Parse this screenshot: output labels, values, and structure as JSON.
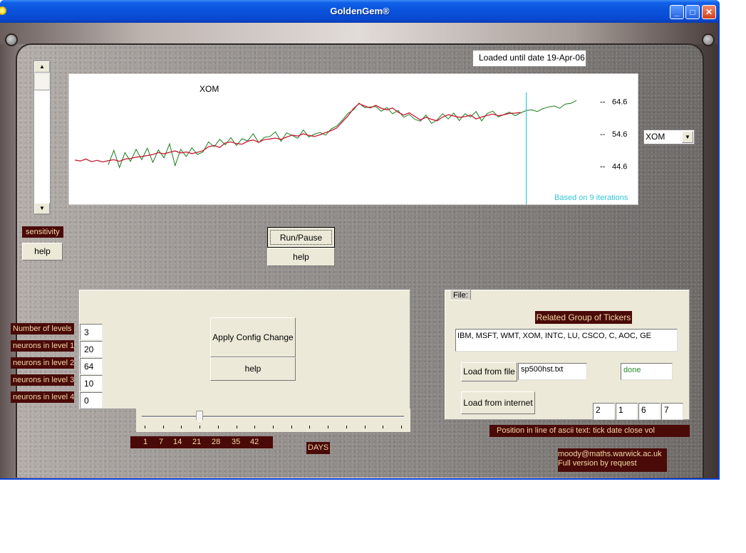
{
  "window": {
    "title": "GoldenGem®",
    "controls": {
      "minimize": "_",
      "maximize": "□",
      "close": "✕"
    }
  },
  "status": {
    "loaded_label": "Loaded until date 19-Apr-06"
  },
  "sensitivity": {
    "label": "sensitivity",
    "help": "help",
    "up_arrow": "▲",
    "down_arrow": "▼"
  },
  "chart_data": {
    "type": "line",
    "title": "XOM",
    "ylabel": "",
    "xlabel": "",
    "y_ticks": [
      64.6,
      54.6,
      44.6
    ],
    "y_tick_labels": [
      "64.6",
      "54.6",
      "44.6"
    ],
    "tick_prefix": "--",
    "ylim": [
      34.6,
      70.0
    ],
    "annotation": "Based on  9 iterations",
    "forecast_start_index": 81,
    "series": [
      {
        "name": "predicted-red",
        "color": "#c81830",
        "values": [
          46.5,
          46.2,
          46.8,
          46.0,
          46.4,
          45.9,
          46.3,
          46.6,
          46.1,
          46.8,
          47.0,
          47.4,
          47.6,
          47.9,
          48.2,
          48.8,
          48.4,
          48.9,
          49.3,
          48.7,
          49.0,
          48.5,
          48.9,
          49.4,
          50.6,
          51.0,
          50.4,
          51.8,
          52.1,
          51.6,
          51.4,
          52.3,
          52.7,
          52.0,
          52.8,
          53.0,
          53.3,
          52.9,
          53.6,
          54.2,
          53.9,
          54.6,
          54.1,
          53.8,
          54.3,
          55.0,
          55.6,
          56.4,
          58.3,
          60.1,
          62.4,
          63.9,
          63.2,
          62.6,
          63.4,
          62.5,
          62.0,
          62.6,
          61.3,
          60.4,
          61.1,
          60.0,
          58.9,
          59.7,
          59.1,
          58.6,
          59.8,
          60.5,
          60.1,
          59.7,
          59.9,
          60.4,
          59.2,
          59.8,
          60.3,
          60.7,
          60.2,
          60.5,
          60.9,
          61.0,
          61.2
        ]
      },
      {
        "name": "actual-green",
        "color": "#1a7a1a",
        "values": [
          null,
          null,
          null,
          null,
          null,
          null,
          45.0,
          49.5,
          44.2,
          48.8,
          46.1,
          49.8,
          46.6,
          50.2,
          45.8,
          49.6,
          47.2,
          51.5,
          44.8,
          49.8,
          47.6,
          50.3,
          48.2,
          49.0,
          52.1,
          50.6,
          52.9,
          51.2,
          53.4,
          51.0,
          53.1,
          52.4,
          54.6,
          51.9,
          53.5,
          53.8,
          55.2,
          52.3,
          54.9,
          54.1,
          53.2,
          55.8,
          53.6,
          54.5,
          55.0,
          54.2,
          56.1,
          57.0,
          58.8,
          60.9,
          62.0,
          64.1,
          62.7,
          62.9,
          63.0,
          61.6,
          62.7,
          60.8,
          61.8,
          59.7,
          60.6,
          59.1,
          58.5,
          60.4,
          57.8,
          58.9,
          60.8,
          59.2,
          61.0,
          58.7,
          60.8,
          59.8,
          61.5,
          58.6,
          60.9,
          61.6,
          59.8,
          60.6,
          61.3,
          60.2,
          61.1,
          61.8,
          62.0,
          61.5,
          62.4,
          62.9,
          63.2,
          62.5,
          63.8,
          64.0,
          64.9
        ]
      }
    ]
  },
  "ticker_select": {
    "value": "XOM",
    "arrow": "▼"
  },
  "run": {
    "run_pause": "Run/Pause",
    "help": "help"
  },
  "config": {
    "levels": [
      {
        "label": "Number of levels",
        "value": "3"
      },
      {
        "label": "neurons in level 1",
        "value": "20"
      },
      {
        "label": "neurons in level 2",
        "value": "64"
      },
      {
        "label": "neurons in level 3",
        "value": "10"
      },
      {
        "label": "neurons in level 4",
        "value": "0"
      }
    ],
    "apply_label": "Apply Config Change",
    "help_label": "help"
  },
  "days_slider": {
    "value": 21,
    "scale_labels": [
      "1",
      "7",
      "14",
      "21",
      "28",
      "35",
      "42"
    ],
    "unit_label": "DAYS"
  },
  "file": {
    "tab_label": "File:",
    "group_label": "Related Group of Tickers",
    "tickers": "IBM, MSFT,  WMT,  XOM,  INTC, LU, CSCO, C,  AOC,  GE",
    "load_file_label": "Load from file",
    "filename": "sp500hst.txt",
    "status": "done",
    "load_internet_label": "Load from internet",
    "positions": [
      "2",
      "1",
      "6",
      "7"
    ],
    "position_caption": "Position in line of ascii text:     tick   date    close     vol"
  },
  "footer": {
    "line1": "moody@maths.warwick.ac.uk",
    "line2": "Full version by request"
  }
}
